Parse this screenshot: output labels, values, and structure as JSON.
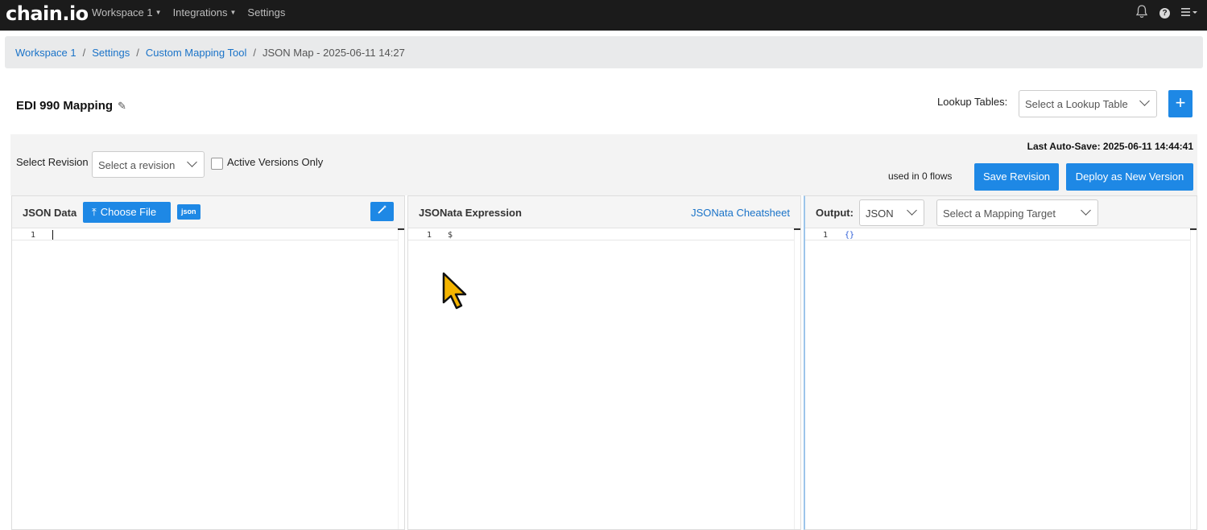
{
  "nav": {
    "logo": "chain.io",
    "links": [
      "Workspace 1",
      "Integrations",
      "Settings"
    ],
    "icons": [
      "bell-icon",
      "help-icon",
      "menu-icon"
    ]
  },
  "breadcrumb": {
    "items": [
      "Workspace 1",
      "Settings",
      "Custom Mapping Tool"
    ],
    "current": "JSON Map - 2025-06-11 14:27"
  },
  "header": {
    "title": "EDI 990 Mapping",
    "lookup_label": "Lookup Tables:",
    "lookup_placeholder": "Select a Lookup Table",
    "add_label": "+"
  },
  "controls": {
    "revision_label": "Select Revision",
    "revision_placeholder": "Select a revision",
    "active_only_label": "Active Versions Only",
    "active_only_checked": false,
    "autosave": "Last Auto-Save: 2025-06-11 14:44:41",
    "used_in": "used in 0 flows",
    "save_label": "Save Revision",
    "deploy_label": "Deploy as New Version"
  },
  "panels": {
    "data": {
      "title": "JSON Data",
      "choose_file": "Choose File",
      "badge": "json",
      "line_number": "1",
      "content": ""
    },
    "expression": {
      "title": "JSONata Expression",
      "cheatsheet": "JSONata Cheatsheet",
      "line_number": "1",
      "content": "$"
    },
    "output": {
      "title": "Output:",
      "format": "JSON",
      "target_placeholder": "Select a Mapping Target",
      "line_number": "1",
      "content": "{}"
    }
  },
  "colors": {
    "nav_bg": "#1b1b1b",
    "primary": "#1e88e5",
    "link": "#1a73c8"
  }
}
